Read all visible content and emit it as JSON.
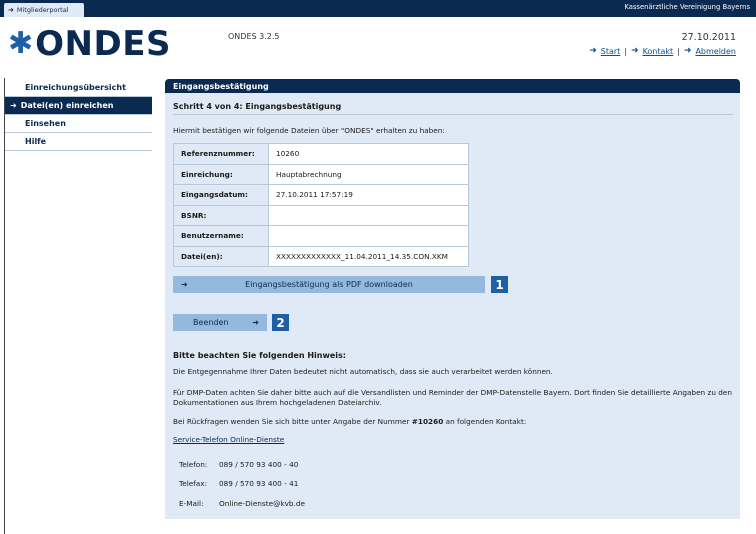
{
  "topbar": {
    "portal_tab": "Mitgliederportal",
    "organization": "Kassenärztliche Vereinigung Bayerns"
  },
  "header": {
    "logo_text": "ONDES",
    "version": "ONDES 3.2.5",
    "date": "27.10.2011",
    "links": {
      "start": "Start",
      "contact": "Kontakt",
      "logout": "Abmelden",
      "separator": "|"
    }
  },
  "sidebar": {
    "items": [
      {
        "label": "Einreichungsübersicht",
        "active": false
      },
      {
        "label": "Datei(en) einreichen",
        "active": true
      },
      {
        "label": "Einsehen",
        "active": false
      },
      {
        "label": "Hilfe",
        "active": false
      }
    ]
  },
  "main": {
    "panel_title": "Eingangsbestätigung",
    "step": "Schritt 4 von 4: Eingangsbestätigung",
    "intro": "Hiermit bestätigen wir folgende Dateien über \"ONDES\" erhalten zu haben:",
    "table": [
      {
        "label": "Referenznummer:",
        "value": "10260"
      },
      {
        "label": "Einreichung:",
        "value": "Hauptabrechnung"
      },
      {
        "label": "Eingangsdatum:",
        "value": "27.10.2011 17:57:19"
      },
      {
        "label": "BSNR:",
        "value": ""
      },
      {
        "label": "Benutzername:",
        "value": ""
      },
      {
        "label": "Datei(en):",
        "value": "XXXXXXXXXXXXX_11.04.2011_14.35.CON.XKM"
      }
    ],
    "pdf_button": "Eingangsbestätigung als PDF downloaden",
    "badge1": "1",
    "end_button": "Beenden",
    "badge2": "2",
    "note_title": "Bitte beachten Sie folgenden Hinweis:",
    "note1": "Die Entgegennahme Ihrer Daten bedeutet nicht automatisch, dass sie auch verarbeitet werden können.",
    "note2": "Für DMP-Daten achten Sie daher bitte auch auf die Versandlisten und Reminder der DMP-Datenstelle Bayern. Dort finden Sie detaillierte Angaben zu den Dokumentationen aus Ihrem hochgeladenen Dateiarchiv.",
    "note3_before": "Bei Rückfragen wenden Sie sich bitte unter Angabe der Nummer ",
    "note3_number": "#10260",
    "note3_after": " an folgenden Kontakt:",
    "service_link": "Service-Telefon Online-Dienste",
    "contacts": [
      {
        "label": "Telefon:",
        "value": "089 / 570 93 400 - 40"
      },
      {
        "label": "Telefax:",
        "value": "089 / 570 93 400 - 41"
      },
      {
        "label": "E-Mail:",
        "value": "Online-Dienste@kvb.de"
      }
    ]
  },
  "colors": {
    "navy": "#0b2a52",
    "panel_bg": "#dfeaf6",
    "button_bg": "#95b9dd",
    "badge": "#1f5fa6"
  }
}
